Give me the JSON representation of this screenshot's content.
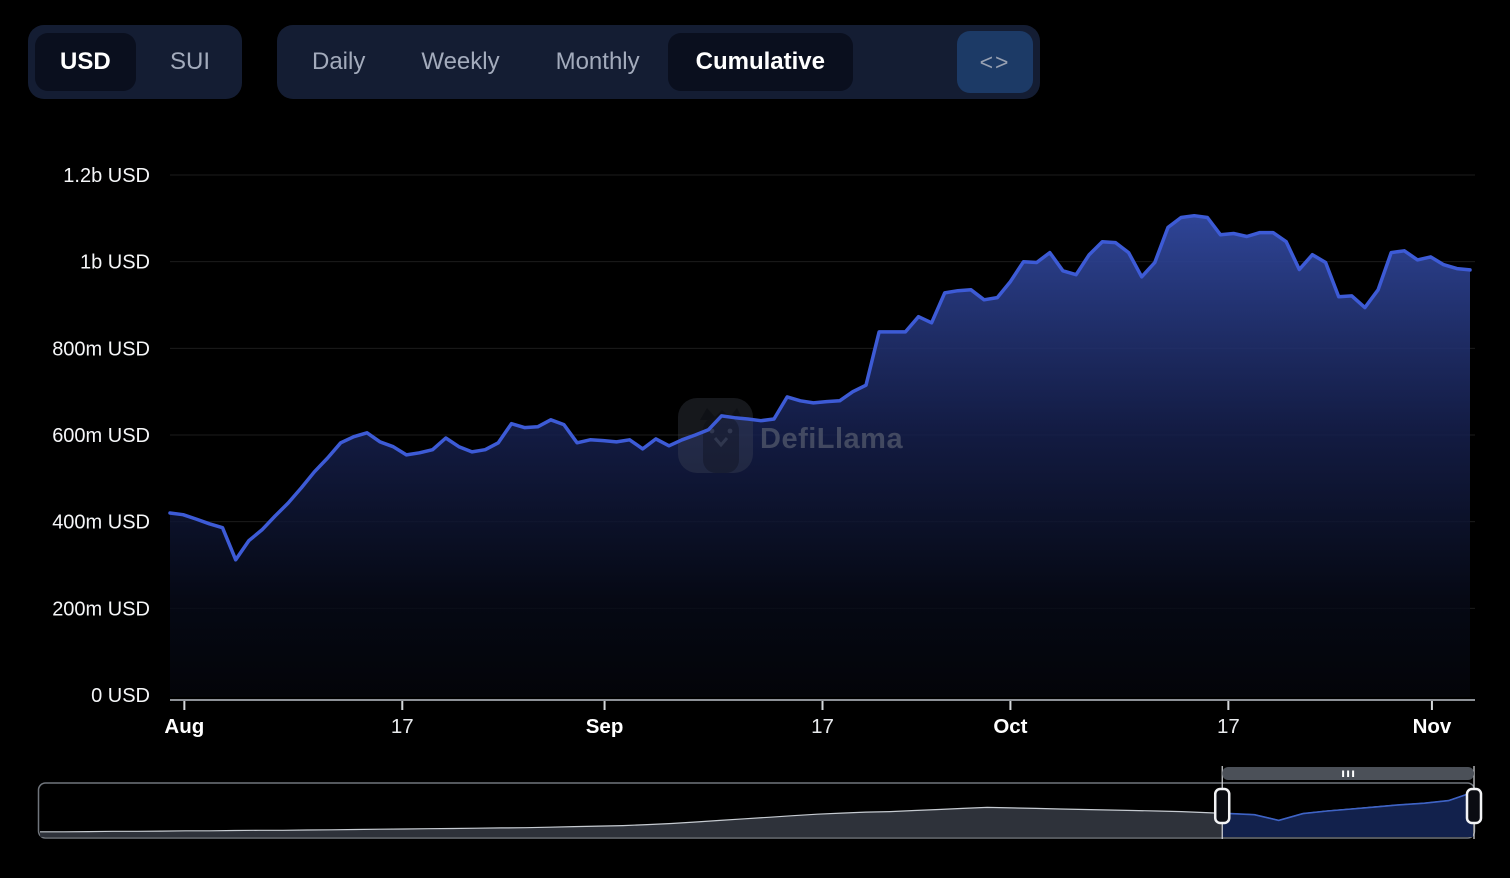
{
  "toolbar": {
    "currency": {
      "options": [
        "USD",
        "SUI"
      ],
      "selected": "USD"
    },
    "interval": {
      "options": [
        "Daily",
        "Weekly",
        "Monthly",
        "Cumulative"
      ],
      "selected": "Cumulative"
    },
    "embed_glyph": "<>"
  },
  "watermark": {
    "text": "DefiLlama"
  },
  "colors": {
    "background": "#000000",
    "line": "#3D5BD6",
    "area_top": "#31489E",
    "group_bg": "#141D33",
    "selected_pill_bg": "#0A0F1E",
    "embed_bg": "#1C3A66",
    "axis_line": "#8D9197",
    "grid_line": "#2A2B2E",
    "label_text": "#F5F6F8",
    "minimap_gray_line": "#C6CBD1",
    "minimap_blue_line": "#3E63C6"
  },
  "chart_data": {
    "type": "area",
    "title": "",
    "unit": "USD",
    "legend": [],
    "y_axis": {
      "min_millions": 0,
      "max_millions": 1200,
      "ticks": [
        {
          "label": "1.2b USD",
          "value": 1200
        },
        {
          "label": "1b USD",
          "value": 1000
        },
        {
          "label": "800m USD",
          "value": 800
        },
        {
          "label": "600m USD",
          "value": 600
        },
        {
          "label": "400m USD",
          "value": 400
        },
        {
          "label": "200m USD",
          "value": 200
        },
        {
          "label": "0 USD",
          "value": 0
        }
      ]
    },
    "x_axis": {
      "range": "Jul 31 - Nov 3",
      "ticks": [
        {
          "label": "Aug",
          "frac": 0.011,
          "bold": true
        },
        {
          "label": "17",
          "frac": 0.178,
          "bold": false
        },
        {
          "label": "Sep",
          "frac": 0.333,
          "bold": true
        },
        {
          "label": "17",
          "frac": 0.5,
          "bold": false
        },
        {
          "label": "Oct",
          "frac": 0.644,
          "bold": true
        },
        {
          "label": "17",
          "frac": 0.811,
          "bold": false
        },
        {
          "label": "Nov",
          "frac": 0.967,
          "bold": true
        }
      ]
    },
    "series": [
      {
        "name": "Cumulative (USD)",
        "values_millions": [
          420,
          416,
          406,
          395,
          386,
          312,
          356,
          381,
          413,
          443,
          478,
          515,
          547,
          582,
          596,
          605,
          584,
          573,
          554,
          559,
          566,
          593,
          573,
          561,
          566,
          582,
          626,
          617,
          619,
          635,
          624,
          582,
          589,
          587,
          584,
          589,
          568,
          591,
          575,
          589,
          600,
          612,
          644,
          640,
          637,
          633,
          637,
          688,
          679,
          674,
          677,
          679,
          700,
          715,
          838,
          838,
          838,
          873,
          859,
          928,
          933,
          935,
          912,
          917,
          954,
          1000,
          998,
          1021,
          979,
          970,
          1016,
          1046,
          1044,
          1021,
          965,
          998,
          1079,
          1102,
          1106,
          1102,
          1062,
          1065,
          1058,
          1067,
          1067,
          1046,
          982,
          1016,
          998,
          919,
          921,
          894,
          935,
          1021,
          1025,
          1004,
          1011,
          993,
          984,
          981
        ]
      }
    ],
    "minimap": {
      "values_norm": [
        0.08,
        0.08,
        0.085,
        0.09,
        0.09,
        0.095,
        0.1,
        0.1,
        0.105,
        0.11,
        0.11,
        0.115,
        0.12,
        0.125,
        0.13,
        0.135,
        0.14,
        0.145,
        0.15,
        0.155,
        0.16,
        0.17,
        0.18,
        0.19,
        0.2,
        0.22,
        0.24,
        0.27,
        0.3,
        0.33,
        0.36,
        0.39,
        0.42,
        0.44,
        0.46,
        0.47,
        0.49,
        0.51,
        0.53,
        0.55,
        0.54,
        0.53,
        0.52,
        0.51,
        0.5,
        0.49,
        0.48,
        0.47,
        0.45,
        0.43,
        0.41,
        0.3,
        0.43,
        0.48,
        0.52,
        0.56,
        0.6,
        0.63,
        0.68,
        0.84
      ],
      "selection": {
        "start_frac": 0.825,
        "end_frac": 1.0
      }
    }
  }
}
